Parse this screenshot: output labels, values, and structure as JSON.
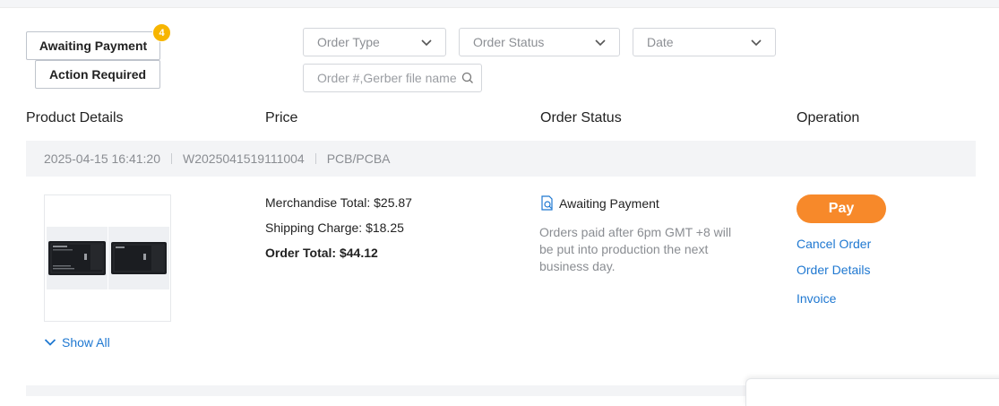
{
  "tabs": {
    "awaiting_payment": "Awaiting Payment",
    "awaiting_payment_count": "4",
    "action_required": "Action Required"
  },
  "filters": {
    "order_type": "Order Type",
    "order_status": "Order Status",
    "date": "Date",
    "search_placeholder": "Order #,Gerber file name"
  },
  "columns": {
    "product_details": "Product Details",
    "price": "Price",
    "order_status": "Order Status",
    "operation": "Operation"
  },
  "order": {
    "datetime": "2025-04-15 16:41:20",
    "number": "W2025041519111004",
    "type": "PCB/PCBA",
    "show_all": "Show All",
    "merchandise_total": "Merchandise Total: $25.87",
    "shipping_charge": "Shipping Charge: $18.25",
    "order_total": "Order Total: $44.12",
    "status": "Awaiting Payment",
    "status_note": "Orders paid after 6pm GMT +8 will be put into production the next business day.",
    "actions": {
      "pay": "Pay",
      "cancel": "Cancel Order",
      "details": "Order Details",
      "invoice": "Invoice"
    }
  },
  "colors": {
    "accent": "#f7892a",
    "link": "#1f78d1",
    "badge": "#f7b500"
  }
}
